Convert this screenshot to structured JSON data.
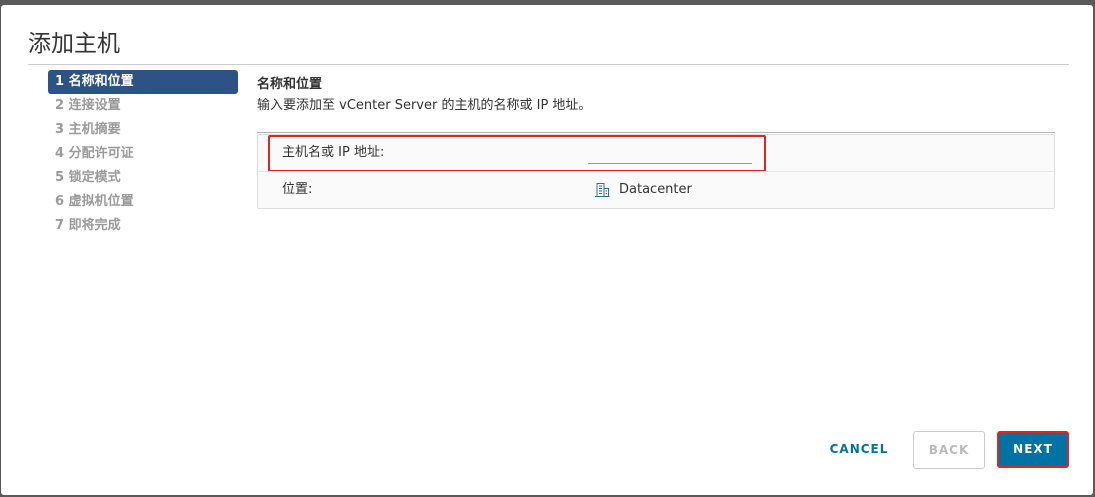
{
  "dialog": {
    "title": "添加主机"
  },
  "steps": [
    {
      "label": "1 名称和位置",
      "active": true
    },
    {
      "label": "2 连接设置",
      "active": false
    },
    {
      "label": "3 主机摘要",
      "active": false
    },
    {
      "label": "4 分配许可证",
      "active": false
    },
    {
      "label": "5 锁定模式",
      "active": false
    },
    {
      "label": "6 虚拟机位置",
      "active": false
    },
    {
      "label": "7 即将完成",
      "active": false
    }
  ],
  "content": {
    "section_title": "名称和位置",
    "section_desc": "输入要添加至 vCenter Server 的主机的名称或 IP 地址。",
    "host_field": {
      "label": "主机名或 IP 地址:",
      "value": "",
      "placeholder": ""
    },
    "location_field": {
      "label": "位置:",
      "value": "Datacenter",
      "icon": "datacenter-icon"
    }
  },
  "footer": {
    "cancel_label": "CANCEL",
    "back_label": "BACK",
    "next_label": "NEXT"
  },
  "colors": {
    "active_step": "#2d5386",
    "primary_button": "#0072a3",
    "highlight": "#e0261f"
  }
}
